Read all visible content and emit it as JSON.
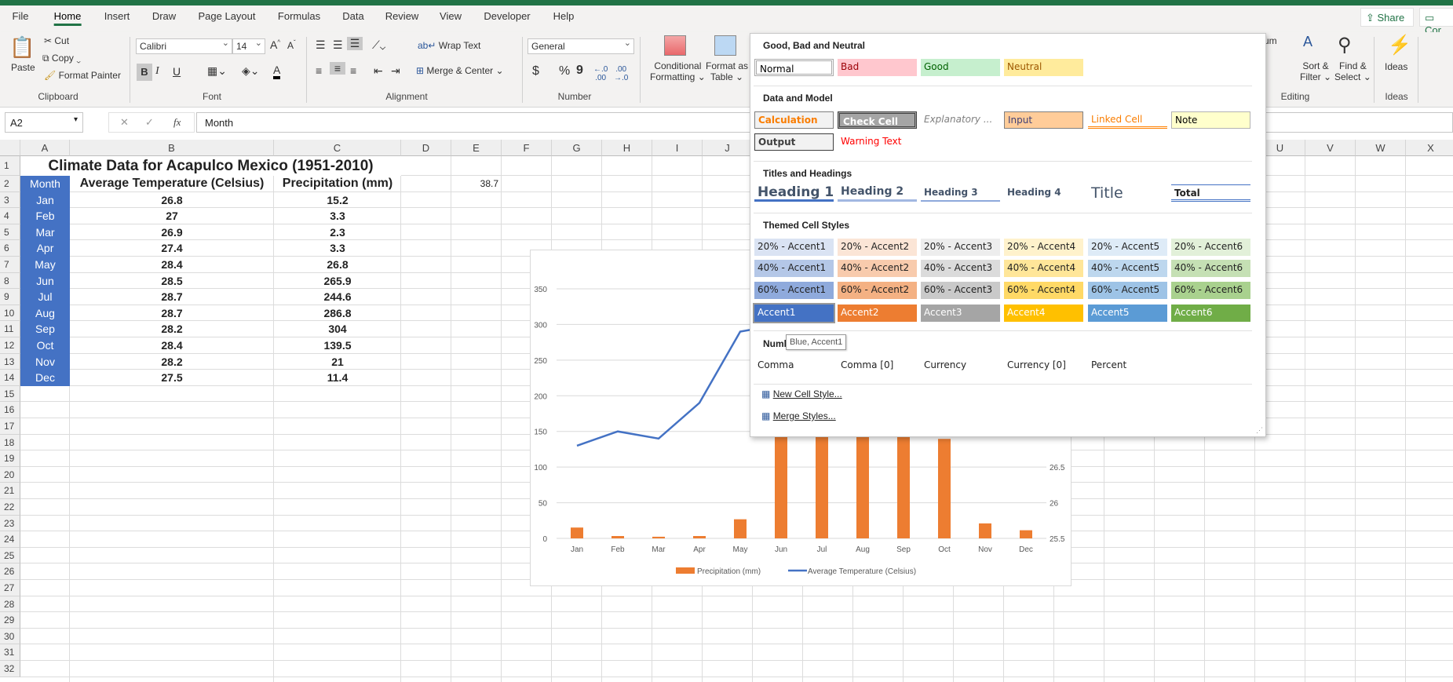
{
  "ribbon_tabs": [
    "File",
    "Home",
    "Insert",
    "Draw",
    "Page Layout",
    "Formulas",
    "Data",
    "Review",
    "View",
    "Developer",
    "Help"
  ],
  "active_tab": "Home",
  "share_label": "Share",
  "comments_label": "Cor",
  "clipboard": {
    "paste": "Paste",
    "cut": "Cut",
    "copy": "Copy",
    "format_painter": "Format Painter",
    "group": "Clipboard"
  },
  "font": {
    "name": "Calibri",
    "size": "14",
    "group": "Font",
    "bold": "B",
    "italic": "I",
    "underline": "U"
  },
  "alignment": {
    "wrap": "Wrap Text",
    "merge": "Merge & Center",
    "group": "Alignment"
  },
  "number": {
    "format": "General",
    "group": "Number",
    "currency": "$",
    "percent": "%",
    "comma": "9"
  },
  "styles_group": {
    "conditional": "Conditional",
    "conditional2": "Formatting",
    "format_as": "Format as",
    "format_as2": "Table"
  },
  "editing": {
    "autosum": "um",
    "sort": "Sort &",
    "sort2": "Filter",
    "find": "Find &",
    "find2": "Select",
    "group": "Editing"
  },
  "ideas": {
    "label": "Ideas",
    "group": "Ideas"
  },
  "formula_bar": {
    "name_box": "A2",
    "fx": "fx",
    "value": "Month"
  },
  "columns": [
    "A",
    "B",
    "C",
    "D",
    "E",
    "F",
    "G",
    "H",
    "I",
    "J",
    "K",
    "L",
    "M",
    "N",
    "O",
    "P",
    "Q",
    "R",
    "S",
    "T",
    "U",
    "V",
    "W",
    "X"
  ],
  "sheet": {
    "title": "Climate Data for Acapulco Mexico (1951-2010)",
    "headers": [
      "Month",
      "Average Temperature (Celsius)",
      "Precipitation (mm)"
    ],
    "e2": "38.7",
    "rows": [
      {
        "month": "Jan",
        "temp": "26.8",
        "precip": "15.2"
      },
      {
        "month": "Feb",
        "temp": "27",
        "precip": "3.3"
      },
      {
        "month": "Mar",
        "temp": "26.9",
        "precip": "2.3"
      },
      {
        "month": "Apr",
        "temp": "27.4",
        "precip": "3.3"
      },
      {
        "month": "May",
        "temp": "28.4",
        "precip": "26.8"
      },
      {
        "month": "Jun",
        "temp": "28.5",
        "precip": "265.9"
      },
      {
        "month": "Jul",
        "temp": "28.7",
        "precip": "244.6"
      },
      {
        "month": "Aug",
        "temp": "28.7",
        "precip": "286.8"
      },
      {
        "month": "Sep",
        "temp": "28.2",
        "precip": "304"
      },
      {
        "month": "Oct",
        "temp": "28.4",
        "precip": "139.5"
      },
      {
        "month": "Nov",
        "temp": "28.2",
        "precip": "21"
      },
      {
        "month": "Dec",
        "temp": "27.5",
        "precip": "11.4"
      }
    ]
  },
  "chart_data": {
    "type": "bar+line",
    "categories": [
      "Jan",
      "Feb",
      "Mar",
      "Apr",
      "May",
      "Jun",
      "Jul",
      "Aug",
      "Sep",
      "Oct",
      "Nov",
      "Dec"
    ],
    "series": [
      {
        "name": "Precipitation (mm)",
        "type": "bar",
        "axis": "left",
        "color": "#ed7d31",
        "values": [
          15.2,
          3.3,
          2.3,
          3.3,
          26.8,
          265.9,
          244.6,
          286.8,
          304,
          139.5,
          21,
          11.4
        ]
      },
      {
        "name": "Average Temperature (Celsius)",
        "type": "line",
        "axis": "right",
        "color": "#4472c4",
        "values": [
          26.8,
          27,
          26.9,
          27.4,
          28.4,
          28.5,
          28.7,
          28.7,
          28.2,
          28.4,
          28.2,
          27.5
        ]
      }
    ],
    "y_left": {
      "range": [
        0,
        350
      ],
      "ticks": [
        "0",
        "50",
        "100",
        "150",
        "200",
        "250",
        "300",
        "350"
      ]
    },
    "y_right": {
      "range": [
        25.5,
        29
      ],
      "ticks_visible": [
        "25.5",
        "26",
        "26.5"
      ]
    },
    "grid": true,
    "legend": "bottom"
  },
  "cell_styles": {
    "sections": [
      "Good, Bad and Neutral",
      "Data and Model",
      "Titles and Headings",
      "Themed Cell Styles",
      "Numb"
    ],
    "good_bad": [
      "Normal",
      "Bad",
      "Good",
      "Neutral"
    ],
    "data_model_1": [
      "Calculation",
      "Check Cell",
      "Explanatory ...",
      "Input",
      "Linked Cell",
      "Note"
    ],
    "data_model_2": [
      "Output",
      "Warning Text"
    ],
    "headings": [
      "Heading 1",
      "Heading 2",
      "Heading 3",
      "Heading 4",
      "Title",
      "Total"
    ],
    "themed_20": [
      "20% - Accent1",
      "20% - Accent2",
      "20% - Accent3",
      "20% - Accent4",
      "20% - Accent5",
      "20% - Accent6"
    ],
    "themed_40": [
      "40% - Accent1",
      "40% - Accent2",
      "40% - Accent3",
      "40% - Accent4",
      "40% - Accent5",
      "40% - Accent6"
    ],
    "themed_60": [
      "60% - Accent1",
      "60% - Accent2",
      "60% - Accent3",
      "60% - Accent4",
      "60% - Accent5",
      "60% - Accent6"
    ],
    "themed_100": [
      "Accent1",
      "Accent2",
      "Accent3",
      "Accent4",
      "Accent5",
      "Accent6"
    ],
    "number_formats": [
      "Comma",
      "Comma [0]",
      "Currency",
      "Currency [0]",
      "Percent"
    ],
    "new_style": "New Cell Style...",
    "merge_styles": "Merge Styles...",
    "tooltip": "Blue, Accent1",
    "accent_colors": [
      "#4472c4",
      "#ed7d31",
      "#a5a5a5",
      "#ffc000",
      "#5b9bd5",
      "#70ad47"
    ],
    "tint20": [
      "#dae3f3",
      "#fbe5d6",
      "#ededed",
      "#fff2cc",
      "#deebf7",
      "#e2f0d9"
    ],
    "tint40": [
      "#b4c7e7",
      "#f8cbad",
      "#dbdbdb",
      "#ffe699",
      "#bdd7ee",
      "#c5e0b4"
    ],
    "tint60": [
      "#8faadc",
      "#f4b183",
      "#c9c9c9",
      "#ffd966",
      "#9dc3e6",
      "#a9d18e"
    ]
  }
}
